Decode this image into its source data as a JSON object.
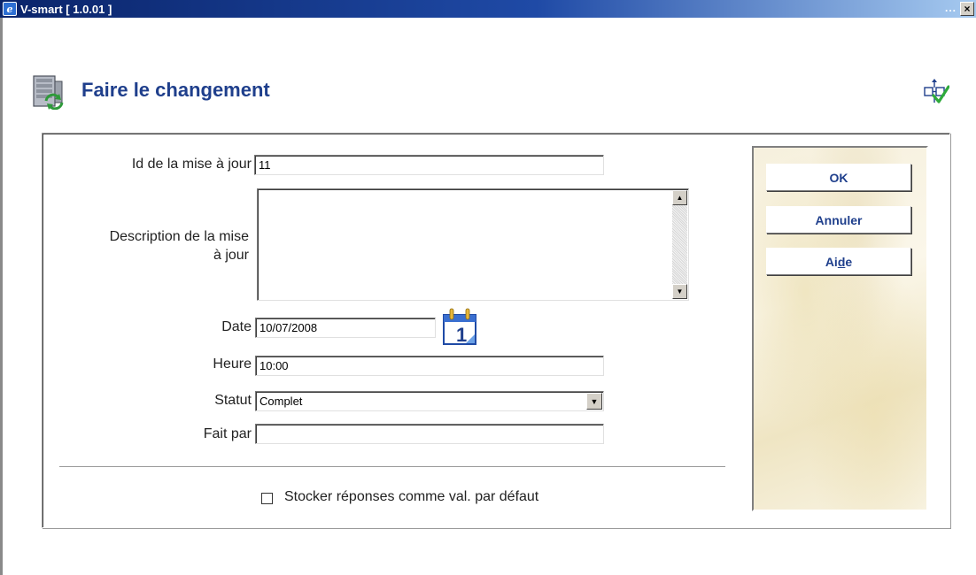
{
  "window": {
    "title": "V-smart [ 1.0.01 ]",
    "ellipsis": "...",
    "close_glyph": "×"
  },
  "page": {
    "title": "Faire le changement"
  },
  "form": {
    "update_id_label": "Id de la mise à jour",
    "update_id_value": "11",
    "description_label_line1": "Description de la mise",
    "description_label_line2": "à jour",
    "description_value": "",
    "date_label": "Date",
    "date_value": "10/07/2008",
    "calendar_day": "1",
    "time_label": "Heure",
    "time_value": "10:00",
    "status_label": "Statut",
    "status_value": "Complet",
    "done_by_label": "Fait par",
    "done_by_value": "",
    "store_defaults_label": "Stocker réponses comme val. par défaut",
    "store_defaults_checked": false
  },
  "buttons": {
    "ok": "OK",
    "cancel": "Annuler",
    "help_pre": "Ai",
    "help_underlined": "d",
    "help_post": "e"
  },
  "colors": {
    "title_blue": "#1f3f8c",
    "titlebar_start": "#0a246a",
    "titlebar_end": "#a6caf0"
  },
  "icons": {
    "app": "ie-icon",
    "header": "server-sync-icon",
    "header_right": "workflow-check-icon",
    "calendar": "calendar-icon",
    "dropdown": "triangle-down-icon"
  }
}
